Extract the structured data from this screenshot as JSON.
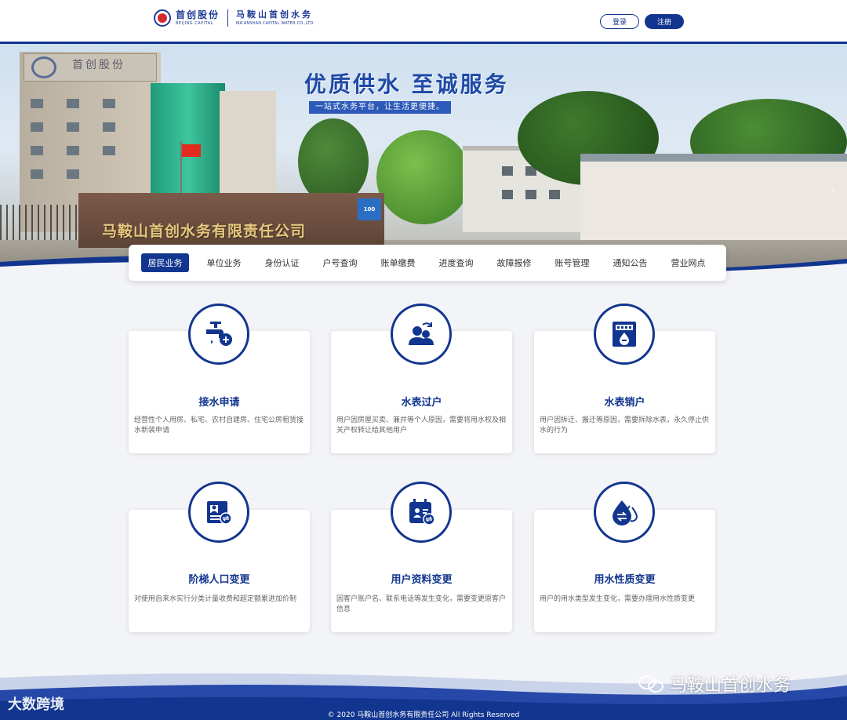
{
  "header": {
    "logo1_cn": "首创股份",
    "logo1_en": "BEIJING CAPITAL",
    "logo2_cn": "马鞍山首创水务",
    "logo2_en": "MA'ANSHAN CAPITAL WATER CO.,LTD.",
    "login_label": "登录",
    "register_label": "注册"
  },
  "banner": {
    "title": "优质供水  至诚服务",
    "subtitle": "一站式水务平台，让生活更便捷。",
    "building_sign": "马鞍山首创水务有限责任公司",
    "roof_sign": "首创股份",
    "board_text": "100"
  },
  "nav": {
    "items": [
      {
        "label": "居民业务",
        "active": true
      },
      {
        "label": "单位业务"
      },
      {
        "label": "身份认证"
      },
      {
        "label": "户号查询"
      },
      {
        "label": "账单缴费"
      },
      {
        "label": "进度查询"
      },
      {
        "label": "故障报修"
      },
      {
        "label": "账号管理"
      },
      {
        "label": "通知公告"
      },
      {
        "label": "营业网点"
      }
    ]
  },
  "services": [
    {
      "title": "接水申请",
      "desc": "经营性个人用房、私宅、农村自建房、住宅公房租赁接水新装申请",
      "icon": "faucet-plus-icon"
    },
    {
      "title": "水表过户",
      "desc": "用户因房屋买卖、兼并等个人原因，需要将用水权及相关产权转让给其他用户",
      "icon": "user-transfer-icon"
    },
    {
      "title": "水表销户",
      "desc": "用户因拆迁、搬迁等原因，需要拆除水表，永久停止供水的行为",
      "icon": "meter-cancel-icon"
    },
    {
      "title": "阶梯人口变更",
      "desc": "对使用自来水实行分类计量收费和超定额累进加价制",
      "icon": "id-card-change-icon"
    },
    {
      "title": "用户资料变更",
      "desc": "因客户账户名、联系电话等发生变化，需要变更原客户信息",
      "icon": "calendar-user-change-icon"
    },
    {
      "title": "用水性质变更",
      "desc": "用户的用水类型发生变化，需要办理用水性质变更",
      "icon": "water-drop-change-icon"
    }
  ],
  "footer": {
    "copyright": "© 2020 马鞍山首创水务有限责任公司 All Rights Reserved",
    "watermark_left": "大数跨境",
    "watermark_right": "马鞍山首创水务"
  },
  "colors": {
    "primary": "#12358f",
    "background": "#f3f4f7"
  }
}
